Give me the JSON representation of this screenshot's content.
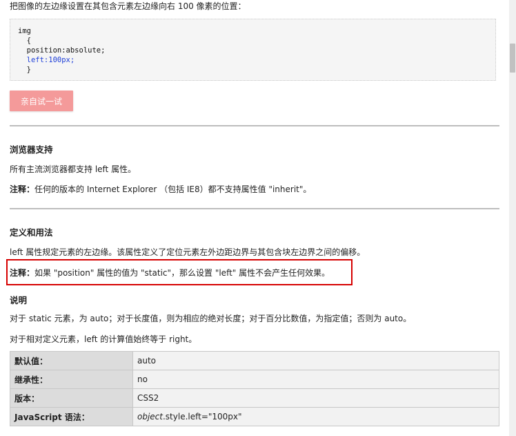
{
  "intro": "把图像的左边缘设置在其包含元素左边缘向右 100 像素的位置：",
  "code": {
    "line1": "img",
    "line2": "  {",
    "line3": "  position:absolute;",
    "line4": "  left:100px;",
    "line5": "  }"
  },
  "try_button": "亲自试一试",
  "support": {
    "heading": "浏览器支持",
    "text": "所有主流浏览器都支持 left 属性。",
    "note_label": "注释：",
    "note_text": "任何的版本的 Internet Explorer （包括 IE8）都不支持属性值 \"inherit\"。"
  },
  "definition": {
    "heading": "定义和用法",
    "text": "left 属性规定元素的左边缘。该属性定义了定位元素左外边距边界与其包含块左边界之间的偏移。",
    "note_label": "注释：",
    "note_text": "如果 \"position\" 属性的值为 \"static\"，那么设置 \"left\" 属性不会产生任何效果。"
  },
  "explanation": {
    "heading": "说明",
    "text1": "对于 static 元素，为 auto；对于长度值，则为相应的绝对长度；对于百分比数值，为指定值；否则为 auto。",
    "text2": "对于相对定义元素，left 的计算值始终等于 right。"
  },
  "table": {
    "rows": [
      {
        "key": "默认值：",
        "value": "auto"
      },
      {
        "key": "继承性：",
        "value": "no"
      },
      {
        "key": "版本：",
        "value": "CSS2"
      },
      {
        "key": "JavaScript 语法：",
        "value_italic": "object",
        "value_rest": ".style.left=\"100px\""
      }
    ]
  },
  "colors": {
    "button": "#f49a9a",
    "highlight_box": "#d60000",
    "code_blue": "#1e3fd8"
  }
}
